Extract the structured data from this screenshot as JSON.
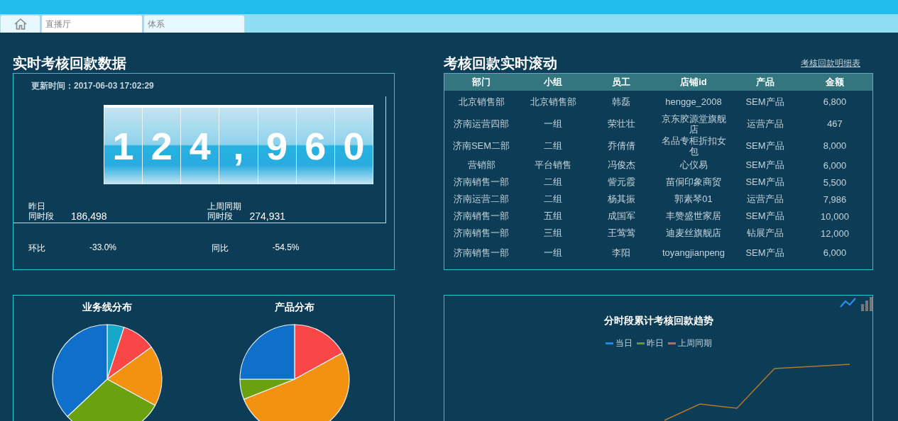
{
  "tabs": [
    {
      "kind": "home",
      "selected": false
    },
    {
      "kind": "text",
      "label": "直播厅",
      "selected": true
    },
    {
      "kind": "text",
      "label": "体系",
      "selected": false
    }
  ],
  "realtime": {
    "title": "实时考核回款数据",
    "updated": "更新时间：2017-06-03 17:02:29",
    "counter": [
      "1",
      "2",
      "4",
      ",",
      "9",
      "6",
      "0"
    ],
    "yesterday": {
      "label1": "昨日",
      "label2": "同时段",
      "value": "186,498"
    },
    "lastweek": {
      "label1": "上周同期",
      "label2": "同时段",
      "value": "274,931"
    },
    "mom": {
      "label": "环比",
      "value": "-33.0%"
    },
    "yoy": {
      "label": "同比",
      "value": "-54.5%"
    }
  },
  "scroll": {
    "title": "考核回款实时滚动",
    "link": "考核回款明细表",
    "columns": [
      "部门",
      "小组",
      "员工",
      "店铺id",
      "产品",
      "金额"
    ],
    "rows": [
      [
        "北京销售部",
        "北京销售部",
        "韩磊",
        "hengge_2008",
        "SEM产品",
        "6,800"
      ],
      [
        "济南运营四部",
        "一组",
        "荣壮壮",
        "京东胶源堂旗舰店",
        "运营产品",
        "467"
      ],
      [
        "济南SEM二部",
        "二组",
        "乔倩倩",
        "名品专柜折扣女包",
        "SEM产品",
        "8,000"
      ],
      [
        "营销部",
        "平台销售",
        "冯俊杰",
        "心仪易",
        "SEM产品",
        "6,000"
      ],
      [
        "济南销售一部",
        "二组",
        "訾元霞",
        "苗侗印象商贸",
        "SEM产品",
        "5,500"
      ],
      [
        "济南运营二部",
        "二组",
        "杨其振",
        "郭素琴01",
        "运营产品",
        "7,986"
      ],
      [
        "济南销售一部",
        "五组",
        "成国军",
        "丰赞盛世家居",
        "SEM产品",
        "10,000"
      ],
      [
        "济南销售一部",
        "三组",
        "王莺莺",
        "迪麦丝旗舰店",
        "钻展产品",
        "12,000"
      ],
      [
        "济南销售一部",
        "一组",
        "李阳",
        "toyangjianpeng",
        "SEM产品",
        "6,000"
      ]
    ]
  },
  "pies": [
    {
      "title": "业务线分布"
    },
    {
      "title": "产品分布"
    }
  ],
  "trend": {
    "title": "分时段累计考核回款趋势",
    "legend": [
      {
        "label": "当日",
        "color": "#1e88e5"
      },
      {
        "label": "昨日",
        "color": "#6a9a1e"
      },
      {
        "label": "上周同期",
        "color": "#b07a2a"
      }
    ]
  }
}
